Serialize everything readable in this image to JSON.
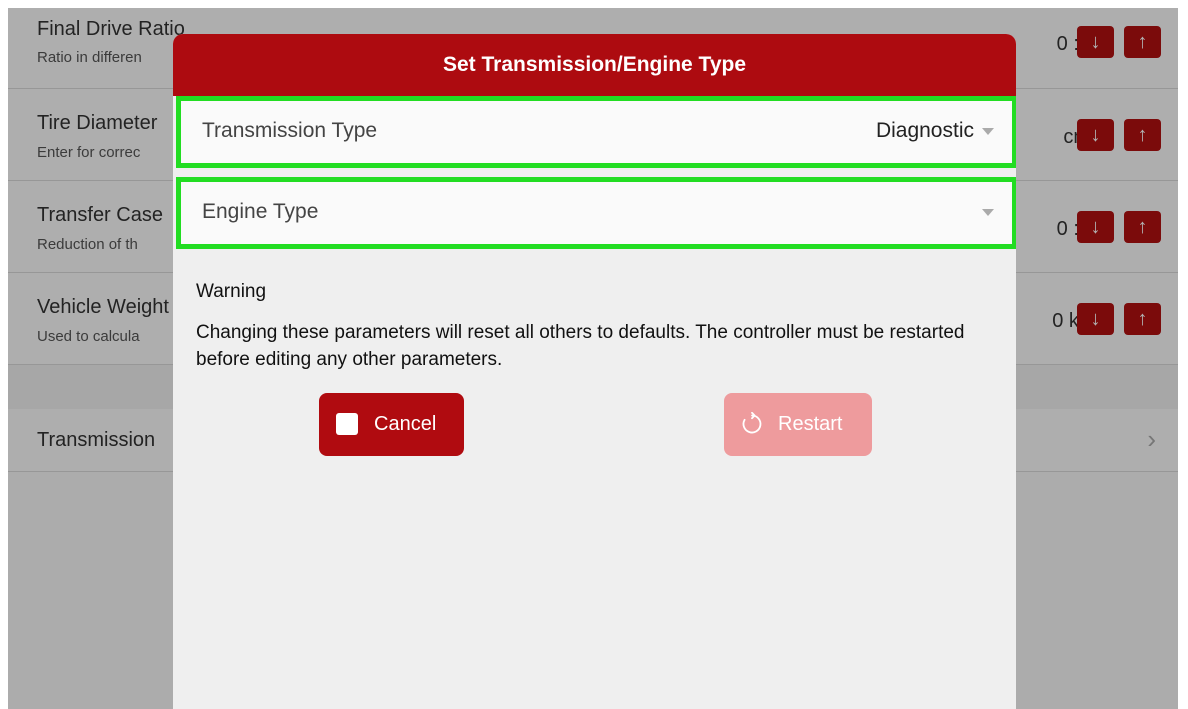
{
  "background": {
    "rows": [
      {
        "title": "Final Drive Ratio",
        "subtitle": "Ratio in differen",
        "value": "0 :1"
      },
      {
        "title": "Tire Diameter",
        "subtitle": "Enter for correc",
        "value": "cm"
      },
      {
        "title": "Transfer Case",
        "subtitle": "Reduction of th",
        "value": "0 :1"
      },
      {
        "title": "Vehicle Weight",
        "subtitle": "Used to calcula",
        "value": "0 kg"
      }
    ],
    "nav_item": "Transmission",
    "chevron": "›",
    "down_arrow": "↓",
    "up_arrow": "↑"
  },
  "modal": {
    "title": "Set Transmission/Engine Type",
    "transmission": {
      "label": "Transmission Type",
      "value": "Diagnostic"
    },
    "engine": {
      "label": "Engine Type",
      "value": ""
    },
    "warning_title": "Warning",
    "warning_text": "Changing these parameters will reset all others to defaults. The controller must be restarted before editing any other parameters.",
    "cancel_label": "Cancel",
    "restart_label": "Restart"
  },
  "colors": {
    "accent": "#ad0b10",
    "highlight": "#22dd22",
    "restart_disabled": "#ee9b9d"
  },
  "icons": {
    "cancel": "checkbox-icon",
    "restart": "refresh-icon",
    "dropdown": "caret-down-icon"
  }
}
